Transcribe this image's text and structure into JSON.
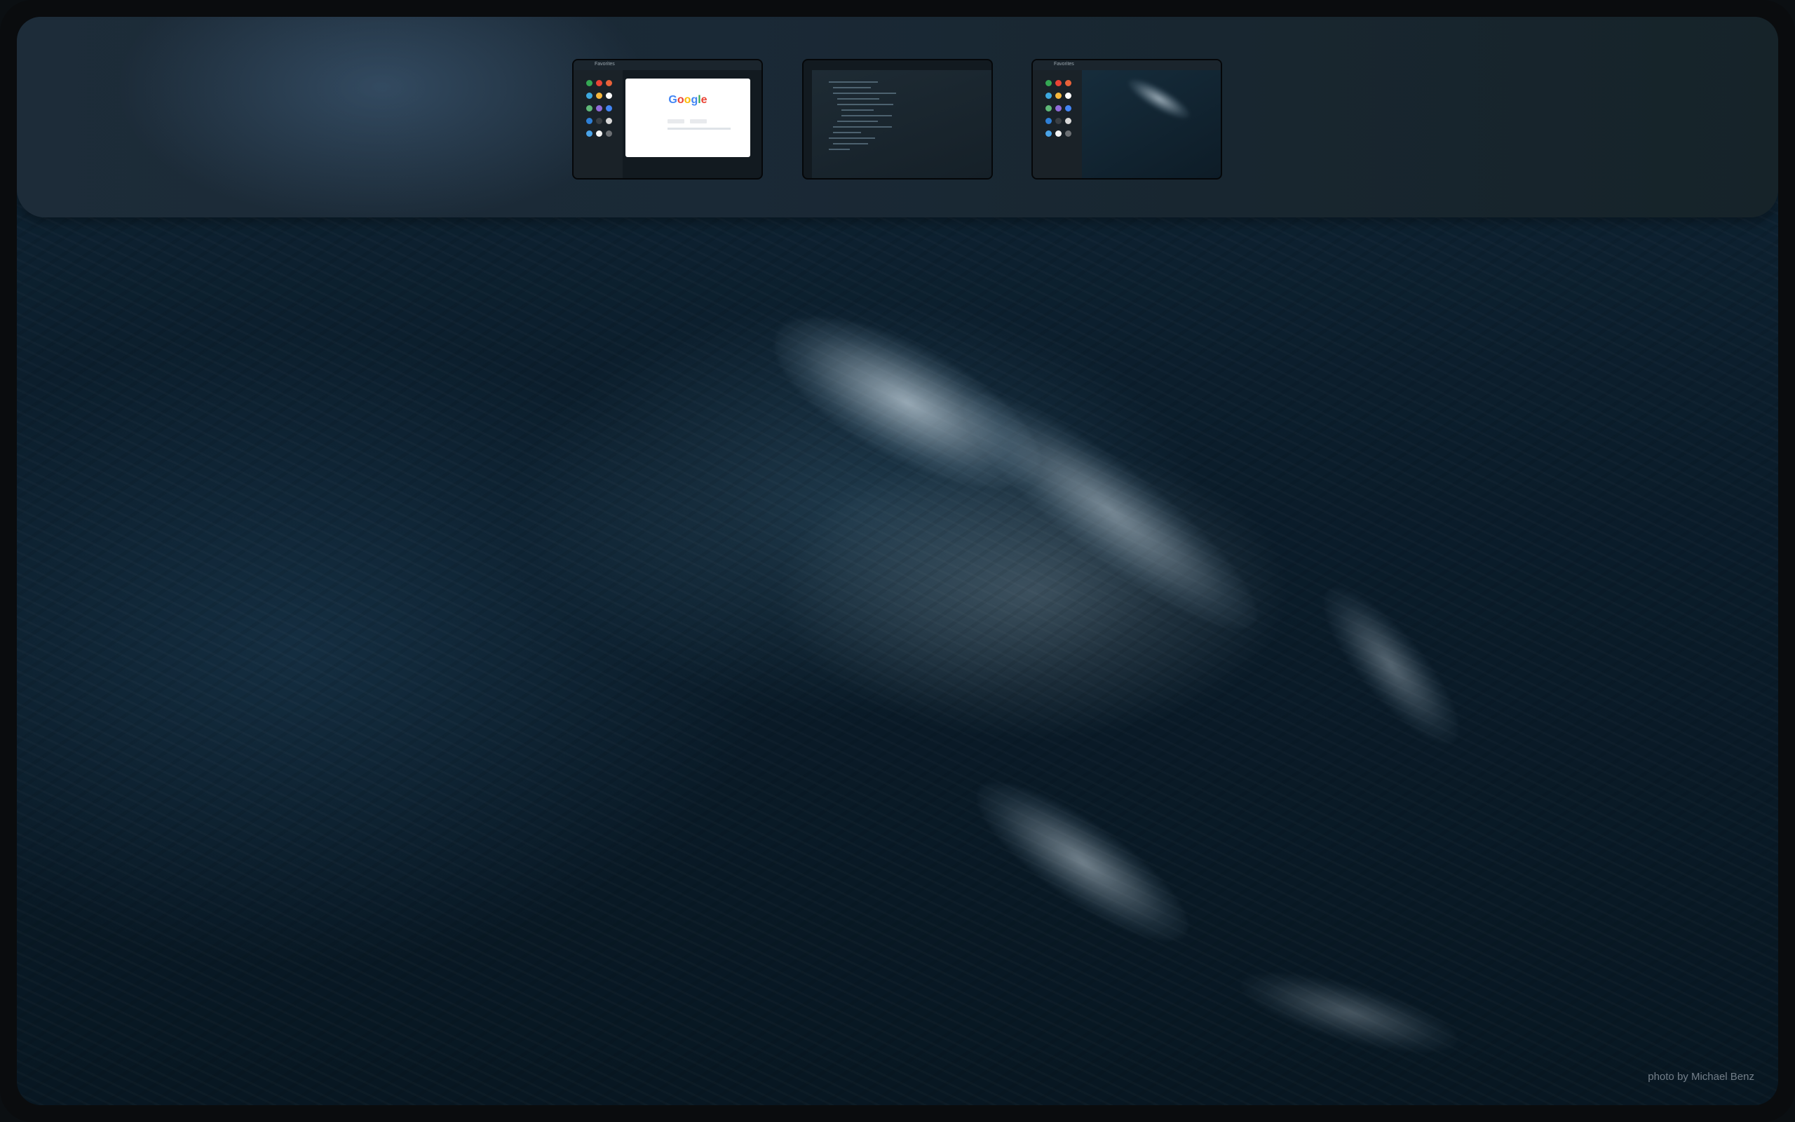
{
  "overview": {
    "windows": [
      {
        "name": "browser-window",
        "launcher_title": "Favorites",
        "search_brand": "Google"
      },
      {
        "name": "code-editor-window"
      },
      {
        "name": "desktop-window",
        "launcher_title": "Favorites"
      }
    ]
  },
  "wallpaper": {
    "credit": "photo by Michael Benz"
  },
  "colors": {
    "google_blue": "#4285F4",
    "google_red": "#EA4335",
    "google_yellow": "#FBBC05",
    "google_green": "#34A853"
  }
}
